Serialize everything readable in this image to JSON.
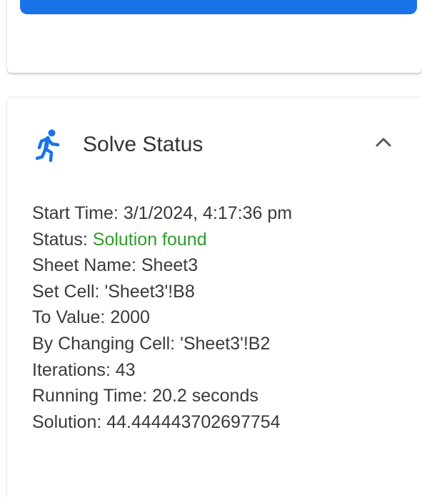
{
  "colors": {
    "accent": "#1a73e8",
    "success": "#2e9c2a",
    "text": "#333333"
  },
  "panel": {
    "title": "Solve Status",
    "icon": "running-person-icon",
    "toggle_icon": "chevron-up-icon",
    "expanded": true
  },
  "details": {
    "start_time_label": "Start Time: ",
    "start_time": "3/1/2024, 4:17:36 pm",
    "status_label": "Status: ",
    "status": "Solution found",
    "sheet_name_label": "Sheet Name: ",
    "sheet_name": "Sheet3",
    "set_cell_label": "Set Cell: ",
    "set_cell": "'Sheet3'!B8",
    "to_value_label": "To Value: ",
    "to_value": "2000",
    "by_changing_label": "By Changing Cell: ",
    "by_changing": "'Sheet3'!B2",
    "iterations_label": "Iterations: ",
    "iterations": "43",
    "running_time_label": "Running Time: ",
    "running_time": "20.2 seconds",
    "solution_label": "Solution: ",
    "solution": "44.444443702697754"
  }
}
